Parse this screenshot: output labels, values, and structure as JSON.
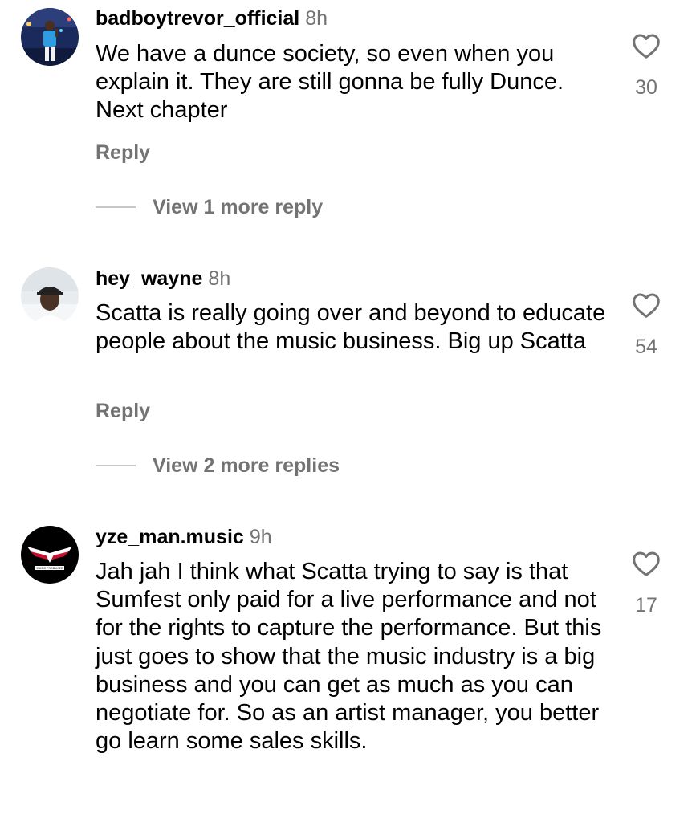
{
  "comments": [
    {
      "username": "badboytrevor_official",
      "time": "8h",
      "text": "We have a dunce society, so even when you explain it. They are still gonna be fully Dunce. Next chapter",
      "reply_label": "Reply",
      "more_replies": "View 1 more reply",
      "likes": "30",
      "icon": "heart-outline-icon"
    },
    {
      "username": "hey_wayne",
      "time": "8h",
      "text": "Scatta is really going over and beyond to educate people about the music business. Big up Scatta",
      "reply_label": "Reply",
      "more_replies": "View 2 more replies",
      "likes": "54",
      "icon": "heart-outline-icon"
    },
    {
      "username": "yze_man.music",
      "time": "9h",
      "text": "Jah jah I think what Scatta trying to say is that Sumfest only paid for a live performance and not for the rights to capture the performance.  But this just goes to show that the music industry is a big business and you can get as much as you can negotiate for. So as an artist manager, you better go learn some sales skills.",
      "likes": "17",
      "icon": "heart-outline-icon",
      "avatar_text": "MUSIC PRODUCER"
    }
  ],
  "colors": {
    "text": "#000000",
    "secondary": "#737373",
    "divider": "#c7c7c7"
  }
}
